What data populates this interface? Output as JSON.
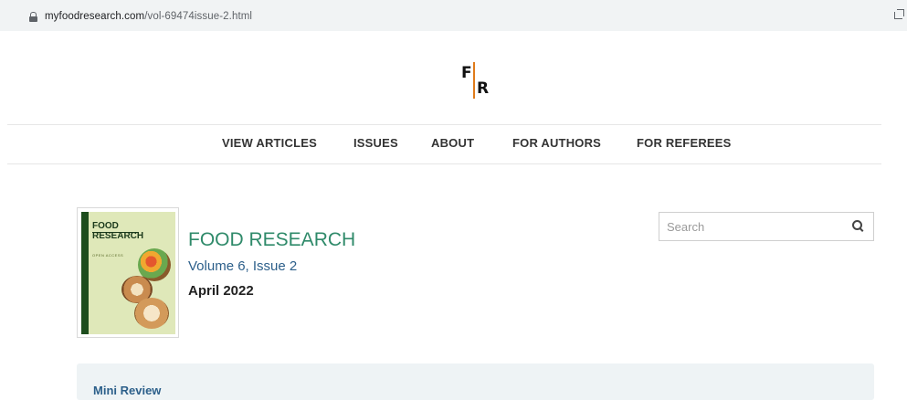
{
  "browser": {
    "url_domain": "myfoodresearch.com",
    "url_path": "/vol-69474issue-2.html"
  },
  "logo": {
    "left_letter": "F",
    "right_letter": "R"
  },
  "nav": {
    "items": [
      {
        "label": "VIEW ARTICLES"
      },
      {
        "label": "ISSUES"
      },
      {
        "label": "ABOUT"
      },
      {
        "label": "FOR AUTHORS"
      },
      {
        "label": "FOR REFEREES"
      }
    ]
  },
  "journal": {
    "title": "FOOD RESEARCH",
    "volume": "Volume 6, Issue 2",
    "date": "April 2022",
    "cover": {
      "title_line1": "FOOD",
      "title_line2": "RESEARCH",
      "subtitle": "OPEN ACCESS"
    }
  },
  "search": {
    "placeholder": "Search"
  },
  "section": {
    "heading": "Mini Review"
  },
  "colors": {
    "accent_green": "#2f8a6a",
    "link_blue": "#2c5f8a",
    "logo_bar": "#e07b1a"
  }
}
